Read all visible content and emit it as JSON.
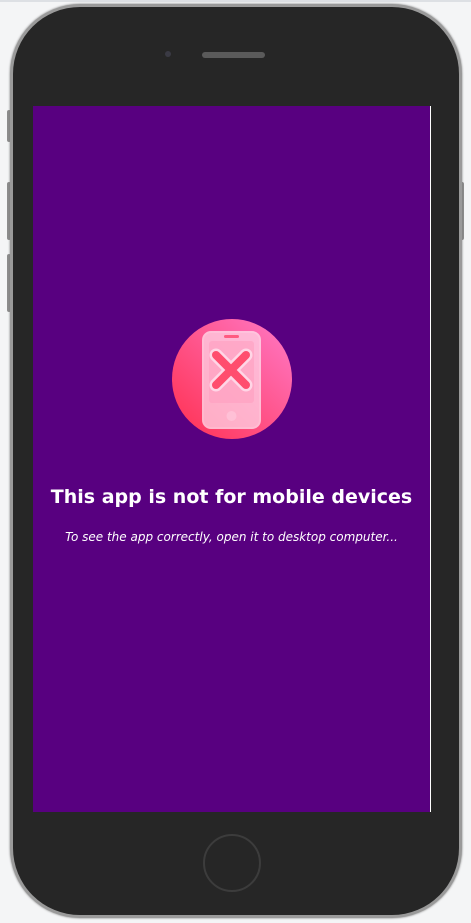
{
  "message": {
    "title": "This app is not for mobile devices",
    "subtitle": "To see the app correctly, open it to desktop computer..."
  },
  "colors": {
    "screen_bg": "#580080",
    "icon_circle": "#ff5f7e"
  },
  "icons": {
    "main": "mobile-blocked-icon"
  }
}
